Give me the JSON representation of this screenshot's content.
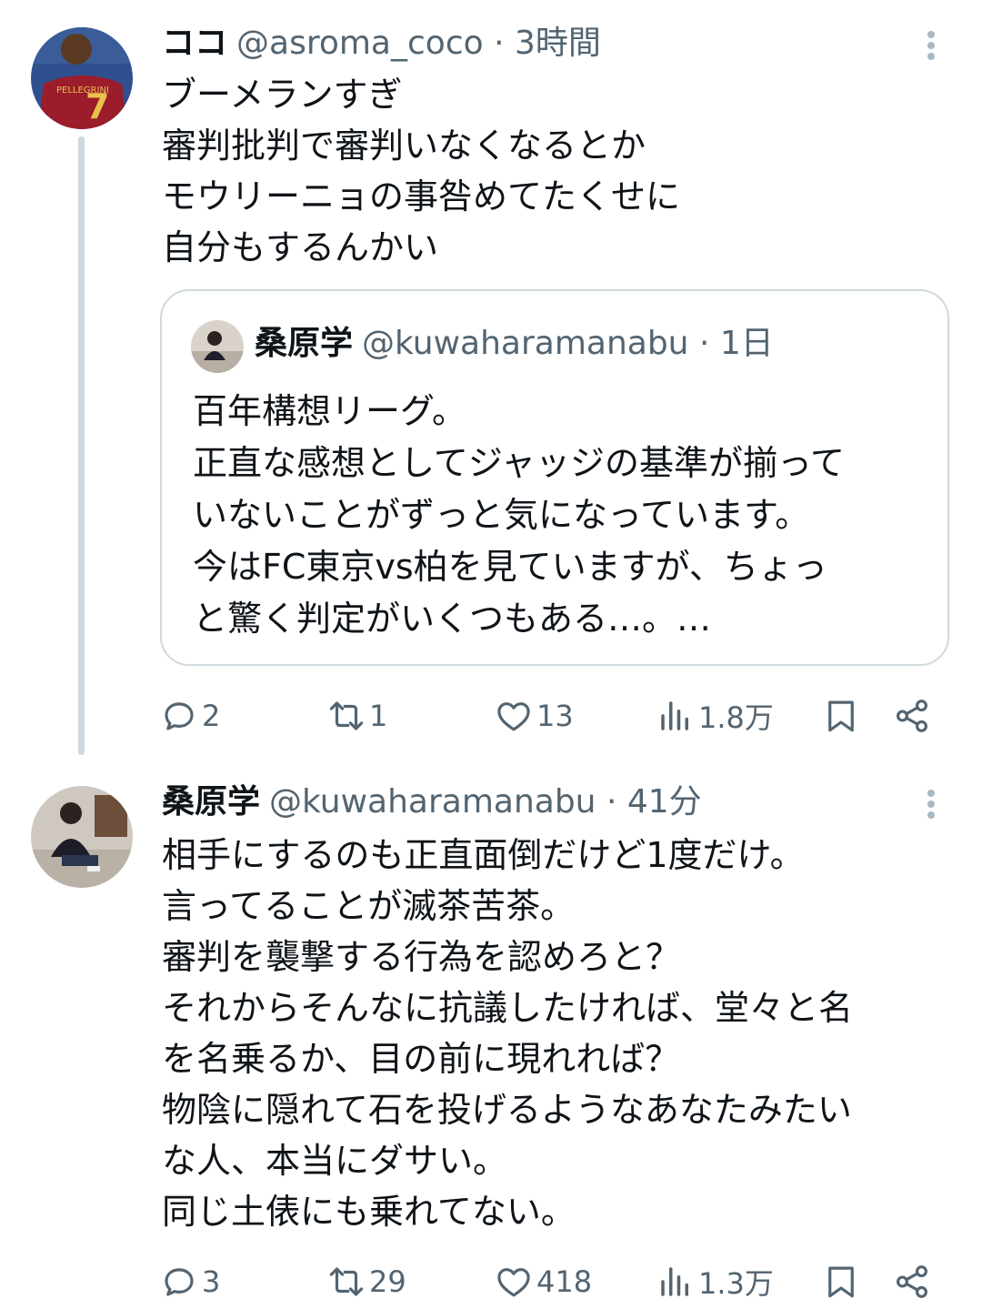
{
  "tweets": [
    {
      "name": "ココ",
      "handle": "@asroma_coco",
      "dot": "·",
      "time": "3時間",
      "lines": [
        "ブーメランすぎ",
        "審判批判で審判いなくなるとか",
        "モウリーニョの事咎めてたくせに",
        "自分もするんかい"
      ],
      "quote": {
        "name": "桑原学",
        "handle": "@kuwaharamanabu",
        "dot": "·",
        "time": "1日",
        "lines": [
          "百年構想リーグ。",
          "正直な感想としてジャッジの基準が揃って",
          "いないことがずっと気になっています。",
          "今はFC東京vs柏を見ていますが、ちょっ",
          "と驚く判定がいくつもある…。…"
        ]
      },
      "actions": {
        "replies": "2",
        "retweets": "1",
        "likes": "13",
        "views": "1.8万"
      }
    },
    {
      "name": "桑原学",
      "handle": "@kuwaharamanabu",
      "dot": "·",
      "time": "41分",
      "lines": [
        "相手にするのも正直面倒だけど1度だけ。",
        "言ってることが滅茶苦茶。",
        "審判を襲撃する行為を認めろと？",
        "それからそんなに抗議したければ、堂々と名",
        "を名乗るか、目の前に現れれば？",
        "物陰に隠れて石を投げるようなあなたみたい",
        "な人、本当にダサい。",
        "同じ土俵にも乗れてない。"
      ],
      "actions": {
        "replies": "3",
        "retweets": "29",
        "likes": "418",
        "views": "1.3万"
      }
    }
  ],
  "colors": {
    "text": "#0f1419",
    "secondary": "#536471",
    "border": "#cfd9de",
    "thread_line": "#cfd9de"
  }
}
